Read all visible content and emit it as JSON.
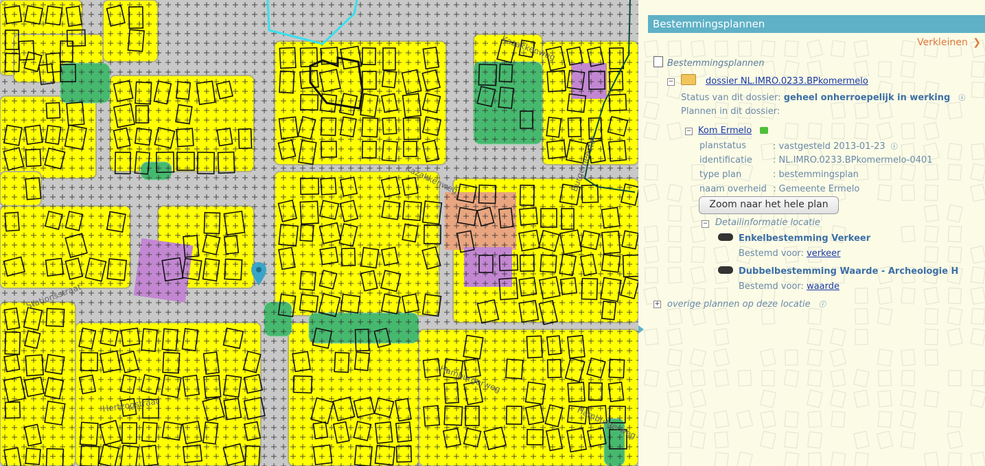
{
  "panel": {
    "title": "Bestemmingsplannen",
    "shrink_label": "Verkleinen",
    "root_label": "Bestemmingsplannen",
    "dossier_link": "dossier NL.IMRO.0233.BPkomermelo",
    "status_label": "Status van dit dossier:",
    "status_value": "geheel onherroepelijk in werking",
    "plans_label": "Plannen in dit dossier:",
    "plan_link": "Kom Ermelo",
    "fields": [
      {
        "key": "planstatus",
        "value": ": vastgesteld 2013-01-23"
      },
      {
        "key": "identificatie",
        "value": ": NL.IMRO.0233.BPkomermelo-0401"
      },
      {
        "key": "type plan",
        "value": ": bestemmingsplan"
      },
      {
        "key": "naam overheid",
        "value": ": Gemeente Ermelo"
      }
    ],
    "zoom_button": "Zoom naar het hele plan",
    "detail_label": "Detailinformatie locatie",
    "items": [
      {
        "title": "Enkelbestemming Verkeer",
        "bestemd_label": "Bestemd voor:",
        "bestemd_link": "verkeer"
      },
      {
        "title": "Dubbelbestemming Waarde - Archeologie H",
        "bestemd_label": "Bestemd voor:",
        "bestemd_link": "waarde"
      }
    ],
    "other_plans": "overige plannen op deze locatie"
  },
  "map": {
    "street_labels": [
      "Kazakkenweg",
      "Hamburgerweg",
      "Hamburgerweg",
      "Hertzogstraat",
      "Stationsstraat",
      "Burgemeester",
      "Kazakkenweg"
    ],
    "colors": {
      "residential": "#ffff00",
      "green": "#46b96e",
      "road": "#c8c8c8",
      "purple": "#c387d2",
      "orange": "#e8a57f",
      "cyan": "#35e0ee",
      "panel_header": "#5fb1c6"
    }
  }
}
